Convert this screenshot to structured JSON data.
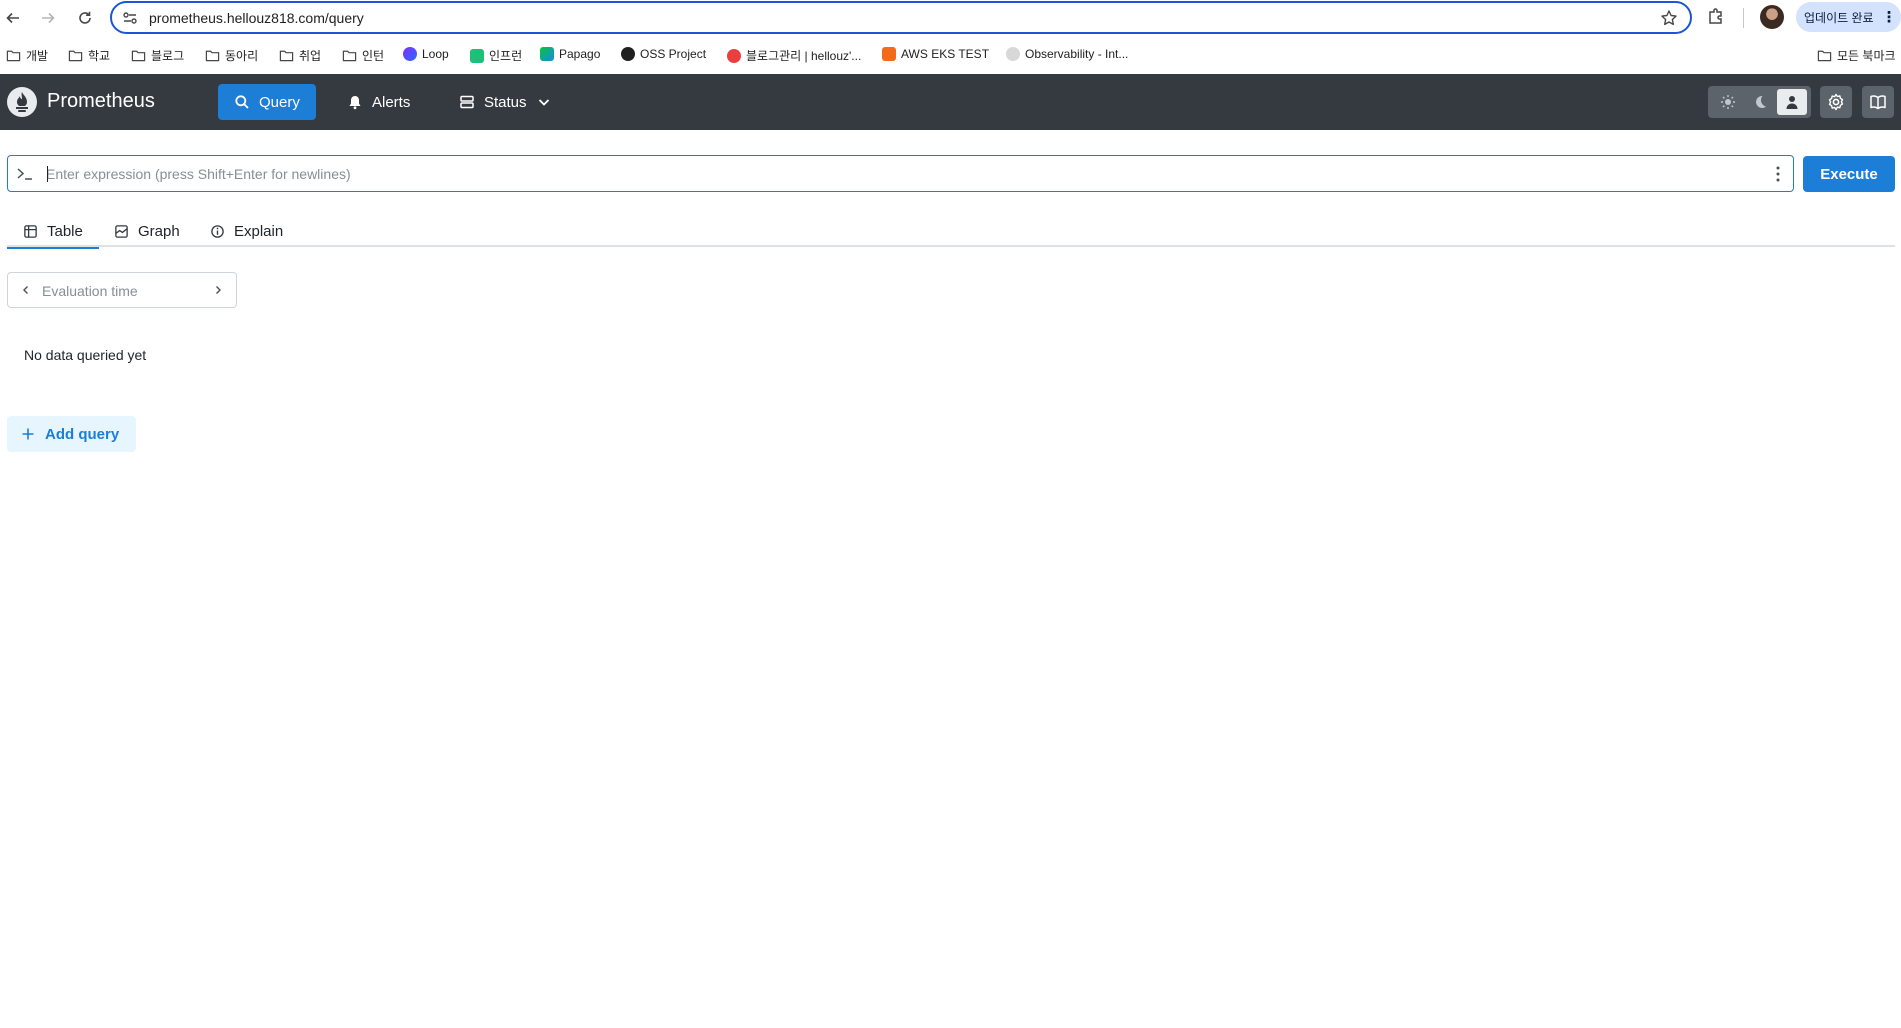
{
  "browser": {
    "url": "prometheus.hellouz818.com/query",
    "update_label": "업데이트 완료",
    "bookmarks": [
      {
        "label": "개발",
        "icon": "folder-icon"
      },
      {
        "label": "학교",
        "icon": "folder-icon"
      },
      {
        "label": "블로그",
        "icon": "folder-icon"
      },
      {
        "label": "동아리",
        "icon": "folder-icon"
      },
      {
        "label": "취업",
        "icon": "folder-icon"
      },
      {
        "label": "인턴",
        "icon": "folder-icon"
      },
      {
        "label": "Loop",
        "icon": "loop-icon"
      },
      {
        "label": "인프런",
        "icon": "inflearn-icon"
      },
      {
        "label": "Papago",
        "icon": "papago-icon"
      },
      {
        "label": "OSS Project",
        "icon": "github-icon"
      },
      {
        "label": "블로그관리 | hellouz'...",
        "icon": "tistory-icon"
      },
      {
        "label": "AWS EKS TEST",
        "icon": "aws-icon"
      },
      {
        "label": "Observability - Int...",
        "icon": "grafana-icon"
      }
    ],
    "all_bookmarks_label": "모든 북마크"
  },
  "app": {
    "brand": "Prometheus",
    "nav": {
      "query": "Query",
      "alerts": "Alerts",
      "status": "Status"
    },
    "theme_options": [
      "light",
      "dark",
      "auto"
    ],
    "theme_selected": "auto",
    "accent_color": "#1c7ed6",
    "header_color": "#343a40"
  },
  "query": {
    "placeholder": "Enter expression (press Shift+Enter for newlines)",
    "value": "",
    "execute_label": "Execute",
    "tabs": [
      "Table",
      "Graph",
      "Explain"
    ],
    "active_tab": "Table",
    "evaluation_time_placeholder": "Evaluation time",
    "empty_message": "No data queried yet",
    "add_query_label": "Add query"
  }
}
